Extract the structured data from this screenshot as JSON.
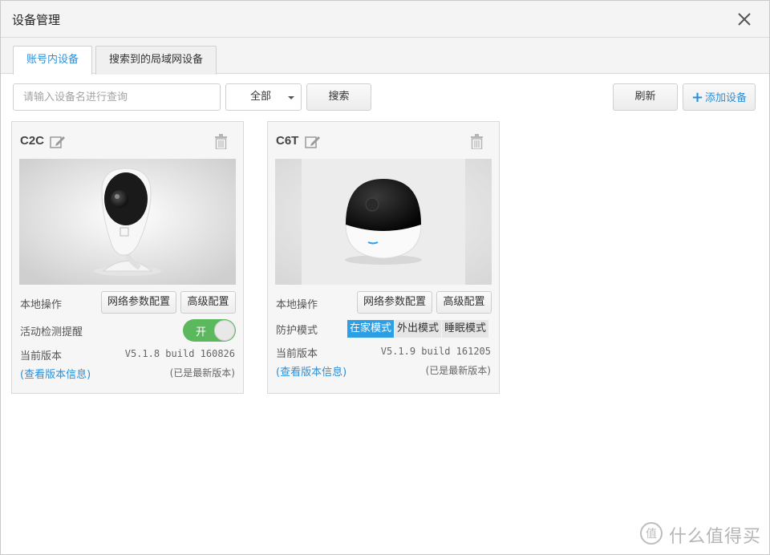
{
  "window": {
    "title": "设备管理"
  },
  "tabs": [
    {
      "label": "账号内设备",
      "active": true
    },
    {
      "label": "搜索到的局域网设备",
      "active": false
    }
  ],
  "toolbar": {
    "search_placeholder": "请输入设备名进行查询",
    "filter_selected": "全部",
    "search_button": "搜索",
    "refresh_button": "刷新",
    "add_button": "添加设备"
  },
  "devices": [
    {
      "name": "C2C",
      "local_ops_label": "本地操作",
      "net_config_button": "网络参数配置",
      "adv_config_button": "高级配置",
      "motion_label": "活动检测提醒",
      "motion_toggle": "开",
      "motion_on": true,
      "version_label": "当前版本",
      "version": "V5.1.8 build 160826",
      "version_info_link": "(查看版本信息)",
      "latest_status": "(已是最新版本)"
    },
    {
      "name": "C6T",
      "local_ops_label": "本地操作",
      "net_config_button": "网络参数配置",
      "adv_config_button": "高级配置",
      "guard_label": "防护模式",
      "modes": [
        "在家模式",
        "外出模式",
        "睡眠模式"
      ],
      "active_mode": "在家模式",
      "version_label": "当前版本",
      "version": "V5.1.9 build 161205",
      "version_info_link": "(查看版本信息)",
      "latest_status": "(已是最新版本)"
    }
  ],
  "watermark": {
    "text": "什么值得买"
  },
  "colors": {
    "accent": "#2c8fd6",
    "toggle_on": "#5cb85c",
    "mode_active": "#2c9fe5"
  },
  "icons": {
    "close": "close-icon",
    "edit": "edit-icon",
    "trash": "trash-icon",
    "plus": "plus-icon"
  }
}
